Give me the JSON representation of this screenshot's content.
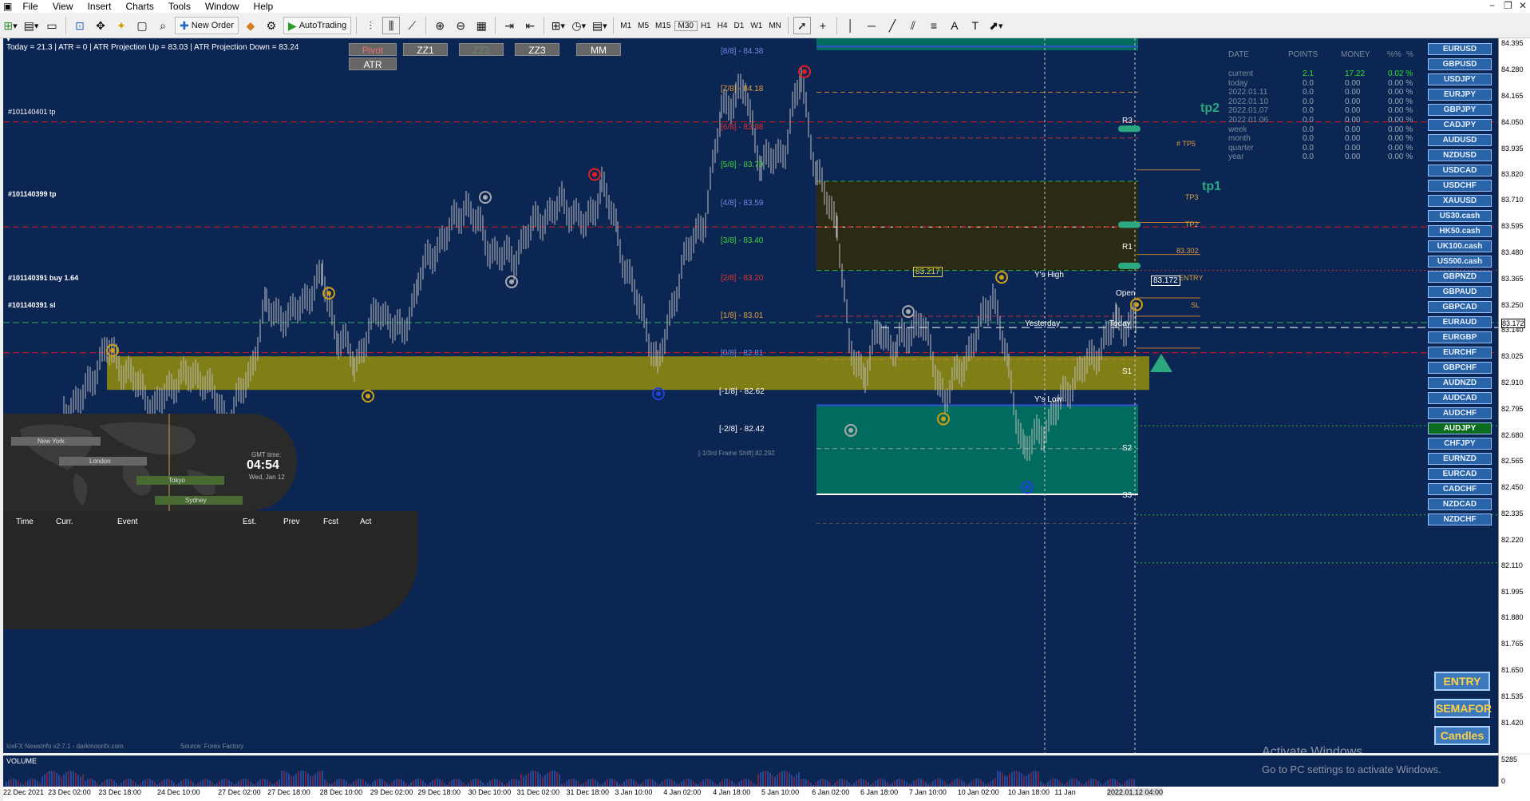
{
  "menu": {
    "items": [
      "File",
      "View",
      "Insert",
      "Charts",
      "Tools",
      "Window",
      "Help"
    ]
  },
  "toolbar": {
    "new_order": "New Order",
    "autotrading": "AutoTrading",
    "timeframes": [
      "M1",
      "M5",
      "M15",
      "M30",
      "H1",
      "H4",
      "D1",
      "W1",
      "MN"
    ]
  },
  "header": {
    "info": "Today = 21.3    |    ATR = 0    |    ATR Projection Up = 83.03    |    ATR Projection Down = 83.24"
  },
  "buttons": {
    "pivot": "Pivot",
    "zz1": "ZZ1",
    "zz2": "ZZ2",
    "zz3": "ZZ3",
    "mm": "MM",
    "atr": "ATR"
  },
  "orders": [
    "#101140401 tp",
    "#101140399 tp",
    "#101140391 buy 1.64",
    "#101140391 sl"
  ],
  "murrey": [
    "[8/8] - 84.38",
    "[7/8] - 84.18",
    "[6/8] - 83.98",
    "[5/8] - 83.79",
    "[4/8] - 83.59",
    "[3/8] - 83.40",
    "[2/8] - 83.20",
    "[1/8] - 83.01",
    "[0/8] - 82.81",
    "[-1/8] - 82.62",
    "[-2/8] - 82.42",
    "[-1/3rd Frame Shift]  82.292"
  ],
  "levels": {
    "tp5": "# TP5",
    "tp3": "TP3",
    "tp2": "TP2",
    "entry": "ENTRY",
    "sl": "SL",
    "tp2_big": "tp2",
    "tp1_big": "tp1",
    "r1": "R1",
    "r3": "R3",
    "s1": "S1",
    "s2": "S2",
    "s3": "S3",
    "level_83302": "83.302",
    "level_83217": "83.217",
    "price_tag": "83.172",
    "open": "Open",
    "yesterday": "Yesterday",
    "today": "Today",
    "y_high": "Y's High",
    "y_low": "Y's Low"
  },
  "stats": {
    "headers": [
      "DATE",
      "POINTS",
      "MONEY",
      "%%",
      "%"
    ],
    "rows": [
      {
        "date": "current",
        "points": "2.1",
        "money": "17.22",
        "pct": "0.02 %"
      },
      {
        "date": "today",
        "points": "0.0",
        "money": "0.00",
        "pct": "0.00 %"
      },
      {
        "date": "2022.01.11",
        "points": "0.0",
        "money": "0.00",
        "pct": "0.00 %"
      },
      {
        "date": "2022.01.10",
        "points": "0.0",
        "money": "0.00",
        "pct": "0.00 %"
      },
      {
        "date": "2022.01.07",
        "points": "0.0",
        "money": "0.00",
        "pct": "0.00 %"
      },
      {
        "date": "2022.01.06",
        "points": "0.0",
        "money": "0.00",
        "pct": "0.00 %"
      },
      {
        "date": "week",
        "points": "0.0",
        "money": "0.00",
        "pct": "0.00 %"
      },
      {
        "date": "month",
        "points": "0.0",
        "money": "0.00",
        "pct": "0.00 %"
      },
      {
        "date": "quarter",
        "points": "0.0",
        "money": "0.00",
        "pct": "0.00 %"
      },
      {
        "date": "year",
        "points": "0.0",
        "money": "0.00",
        "pct": "0.00 %"
      }
    ]
  },
  "symbols": [
    "EURUSD",
    "GBPUSD",
    "USDJPY",
    "EURJPY",
    "GBPJPY",
    "CADJPY",
    "AUDUSD",
    "NZDUSD",
    "USDCAD",
    "USDCHF",
    "XAUUSD",
    "US30.cash",
    "HK50.cash",
    "UK100.cash",
    "US500.cash",
    "GBPNZD",
    "GBPAUD",
    "GBPCAD",
    "EURAUD",
    "EURGBP",
    "EURCHF",
    "GBPCHF",
    "AUDNZD",
    "AUDCAD",
    "AUDCHF",
    "AUDJPY",
    "CHFJPY",
    "EURNZD",
    "EURCAD",
    "CADCHF",
    "NZDCAD",
    "NZDCHF"
  ],
  "active_symbol": "AUDJPY",
  "side_buttons": {
    "entry": "ENTRY",
    "semafor": "SEMAFOR",
    "candles": "Candles"
  },
  "news": {
    "sessions": [
      "New York",
      "London",
      "Tokyo",
      "Sydney"
    ],
    "gmt_label": "GMT time:",
    "gmt_time": "04:54",
    "gmt_date": "Wed, Jan 12",
    "columns": [
      "Time",
      "Curr.",
      "Event",
      "Est.",
      "Prev",
      "Fcst",
      "Act"
    ],
    "footer": "IceFX NewsInfo v2.7.1  -  darkmoonfx.com",
    "source": "Source: Forex Factory"
  },
  "volume_label": "VOLUME",
  "activate": {
    "title": "Activate Windows",
    "sub": "Go to PC settings to activate Windows."
  },
  "price_axis": [
    "84.395",
    "84.280",
    "84.165",
    "84.050",
    "83.935",
    "83.820",
    "83.710",
    "83.595",
    "83.480",
    "83.365",
    "83.250",
    "83.172",
    "83.140",
    "83.025",
    "82.910",
    "82.795",
    "82.680",
    "82.565",
    "82.450",
    "82.335",
    "82.220",
    "82.110",
    "81.995",
    "81.880",
    "81.765",
    "81.650",
    "81.535",
    "81.420"
  ],
  "vol_axis": [
    "5285",
    "0"
  ],
  "time_axis": [
    "22 Dec 2021",
    "23 Dec 02:00",
    "23 Dec 18:00",
    "24 Dec 10:00",
    "27 Dec 02:00",
    "27 Dec 18:00",
    "28 Dec 10:00",
    "29 Dec 02:00",
    "29 Dec 18:00",
    "30 Dec 10:00",
    "31 Dec 02:00",
    "31 Dec 18:00",
    "3 Jan 10:00",
    "4 Jan 02:00",
    "4 Jan 18:00",
    "5 Jan 10:00",
    "6 Jan 02:00",
    "6 Jan 18:00",
    "7 Jan 10:00",
    "10 Jan 02:00",
    "10 Jan 18:00",
    "11 Jan",
    "2022.01.12 04:00"
  ],
  "colors": {
    "chart_bg": "#0c2654",
    "candle": "#c8c8c8",
    "gold_band": "#8a8612",
    "teal_box": "#006b5e",
    "olive_box": "#2b2a14",
    "red_line": "#d01818",
    "accent_green": "#2ca880"
  }
}
